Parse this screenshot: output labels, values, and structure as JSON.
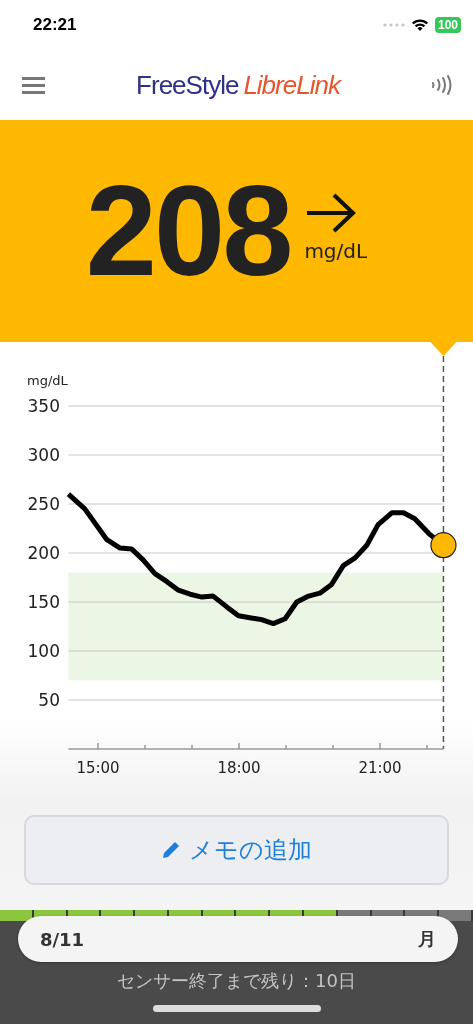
{
  "status_bar": {
    "time": "22:21",
    "battery": "100"
  },
  "header": {
    "brand": "FreeStyle",
    "product": "LibreLink"
  },
  "reading": {
    "value": "208",
    "unit": "mg/dL"
  },
  "chart": {
    "chart_data": {
      "type": "line",
      "ylabel": "mg/dL",
      "x": [
        14.37,
        14.72,
        15.18,
        15.47,
        15.72,
        15.96,
        16.21,
        16.46,
        16.71,
        16.96,
        17.21,
        17.45,
        17.74,
        17.99,
        18.23,
        18.48,
        18.73,
        18.98,
        19.23,
        19.48,
        19.72,
        19.97,
        20.22,
        20.47,
        20.72,
        20.96,
        21.25,
        21.5,
        21.74,
        22.06,
        22.35
      ],
      "values": [
        260,
        245,
        214,
        205,
        204,
        193,
        179,
        171,
        162,
        158,
        155,
        156,
        145,
        136,
        134,
        132,
        128,
        133,
        150,
        156,
        159,
        168,
        187,
        195,
        208,
        229,
        241,
        241,
        235,
        219,
        208
      ],
      "xlim": [
        14.37,
        22.35
      ],
      "ylim": [
        0,
        350
      ],
      "xticks": [
        {
          "value": 15,
          "label": "15:00"
        },
        {
          "value": 18,
          "label": "18:00"
        },
        {
          "value": 21,
          "label": "21:00"
        }
      ],
      "yticks": [
        50,
        100,
        150,
        200,
        250,
        300,
        350
      ],
      "grid": true,
      "bands": [
        {
          "axis": "y",
          "from": 70,
          "to": 180
        }
      ]
    }
  },
  "memo_button": {
    "label": "メモの追加"
  },
  "sensor": {
    "level": 0.71,
    "remaining": "センサー終了まで残り：10日"
  },
  "date_pill": {
    "date": "8/11",
    "weekday": "月"
  }
}
